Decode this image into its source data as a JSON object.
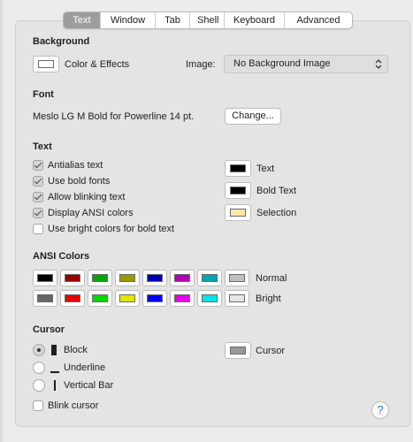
{
  "tabs": [
    "Text",
    "Window",
    "Tab",
    "Shell",
    "Keyboard",
    "Advanced"
  ],
  "active_tab": "Text",
  "background": {
    "heading": "Background",
    "color_effects_label": "Color & Effects",
    "image_label": "Image:",
    "image_value": "No Background Image",
    "swatch_color": "#ffffff"
  },
  "font": {
    "heading": "Font",
    "value": "Meslo LG M Bold for Powerline 14 pt.",
    "change_button": "Change..."
  },
  "text": {
    "heading": "Text",
    "options": [
      {
        "label": "Antialias text",
        "checked": true
      },
      {
        "label": "Use bold fonts",
        "checked": true
      },
      {
        "label": "Allow blinking text",
        "checked": true
      },
      {
        "label": "Display ANSI colors",
        "checked": true
      },
      {
        "label": "Use bright colors for bold text",
        "checked": false
      }
    ],
    "colors": [
      {
        "label": "Text",
        "color": "#000000"
      },
      {
        "label": "Bold Text",
        "color": "#000000"
      },
      {
        "label": "Selection",
        "color": "#fde8a8"
      }
    ]
  },
  "ansi": {
    "heading": "ANSI Colors",
    "normal_label": "Normal",
    "bright_label": "Bright",
    "normal": [
      "#000000",
      "#990000",
      "#00a600",
      "#999900",
      "#0000b2",
      "#b200b2",
      "#00a6b2",
      "#bfbfbf"
    ],
    "bright": [
      "#666666",
      "#e50000",
      "#00d900",
      "#e5e500",
      "#0000ff",
      "#e500e5",
      "#00e5e5",
      "#e5e5e5"
    ]
  },
  "cursor": {
    "heading": "Cursor",
    "options": [
      {
        "label": "Block",
        "icon": "block-cursor-icon",
        "selected": true
      },
      {
        "label": "Underline",
        "icon": "underline-cursor-icon",
        "selected": false
      },
      {
        "label": "Vertical Bar",
        "icon": "vertical-bar-cursor-icon",
        "selected": false
      }
    ],
    "blink_label": "Blink cursor",
    "blink_checked": false,
    "color_label": "Cursor",
    "color": "#999999"
  },
  "help_label": "?"
}
